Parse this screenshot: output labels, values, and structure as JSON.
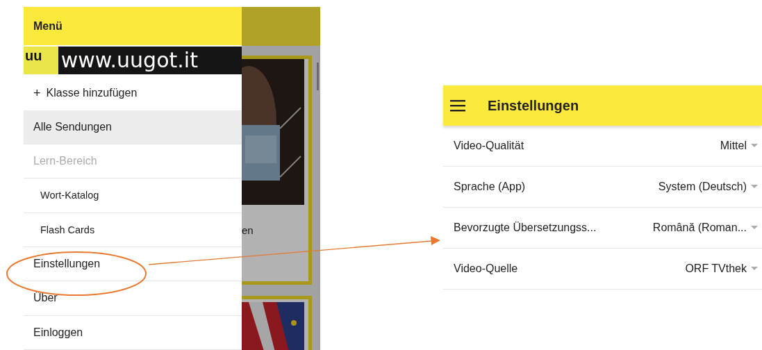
{
  "drawer": {
    "title": "Menü",
    "logo": {
      "mark": "uu",
      "text": "www.uugot.it"
    },
    "items": [
      {
        "kind": "action",
        "icon": "+",
        "label": "Klasse hinzufügen",
        "selected": false,
        "disabled": false
      },
      {
        "kind": "item",
        "label": "Alle Sendungen",
        "selected": true,
        "disabled": false
      },
      {
        "kind": "item",
        "label": "Lern-Bereich",
        "selected": false,
        "disabled": true
      },
      {
        "kind": "subitem",
        "label": "Wort-Katalog",
        "selected": false,
        "disabled": false
      },
      {
        "kind": "subitem",
        "label": "Flash Cards",
        "selected": false,
        "disabled": false
      },
      {
        "kind": "item",
        "label": "Einstellungen",
        "selected": false,
        "disabled": false,
        "highlighted": true
      },
      {
        "kind": "item",
        "label": "Über",
        "selected": false,
        "disabled": false
      },
      {
        "kind": "item",
        "label": "Einloggen",
        "selected": false,
        "disabled": false
      }
    ]
  },
  "background": {
    "cards": [
      {
        "kind": "picture",
        "caption": "en"
      },
      {
        "kind": "picture"
      }
    ]
  },
  "settings": {
    "title": "Einstellungen",
    "rows": [
      {
        "label": "Video-Qualität",
        "value": "Mittel"
      },
      {
        "label": "Sprache (App)",
        "value": "System (Deutsch)"
      },
      {
        "label": "Bevorzugte Übersetzungss...",
        "value": "Română (Roman..."
      },
      {
        "label": "Video-Quelle",
        "value": "ORF TVthek"
      }
    ]
  }
}
